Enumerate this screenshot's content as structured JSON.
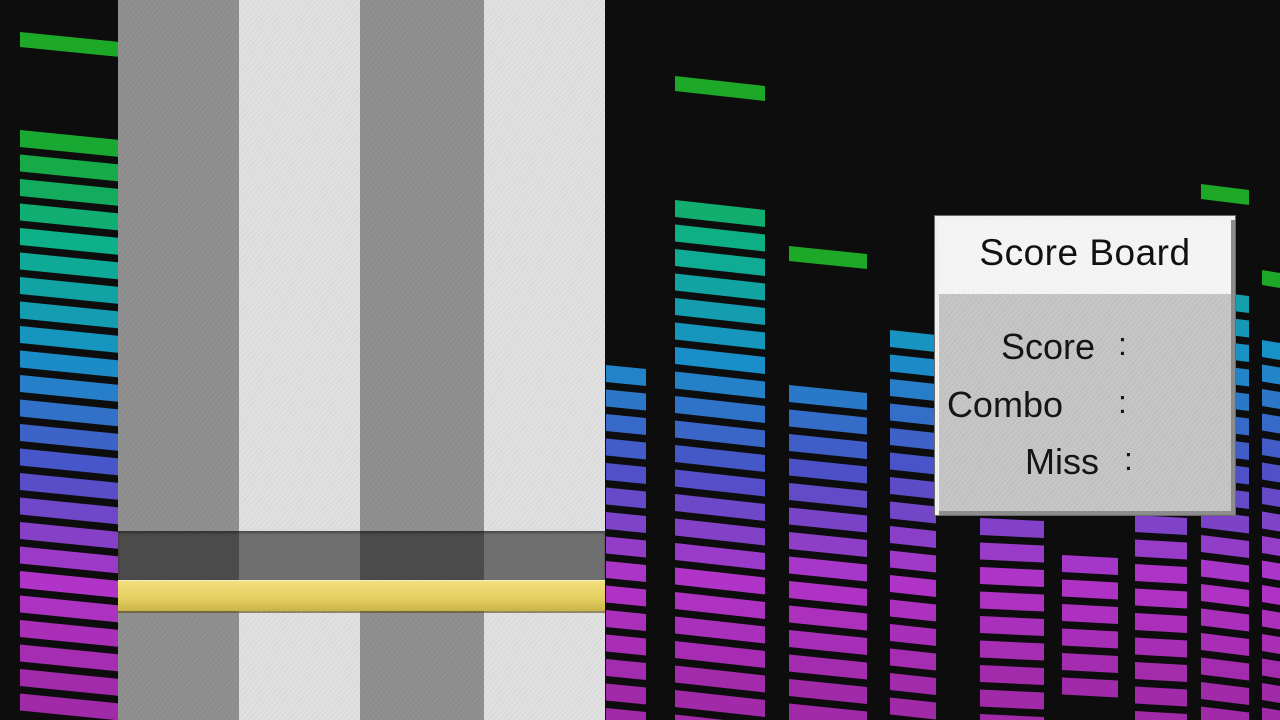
{
  "score_board": {
    "title": "Score Board",
    "score_label": "Score",
    "combo_label": "Combo",
    "miss_label": "Miss",
    "separator": ":",
    "score_value": "",
    "combo_value": "",
    "miss_value": ""
  },
  "play_field": {
    "lane_count": 4,
    "lane_colors": [
      "#8f8f8f",
      "#e2e2e2",
      "#8f8f8f",
      "#e2e2e2"
    ],
    "judge_line_color": "#e6d060"
  },
  "background": {
    "style": "audio equalizer",
    "gradient_colors": [
      "#1aa82a",
      "#0db08c",
      "#1890c8",
      "#4a52c8",
      "#b034c8",
      "#a02aa8"
    ]
  }
}
